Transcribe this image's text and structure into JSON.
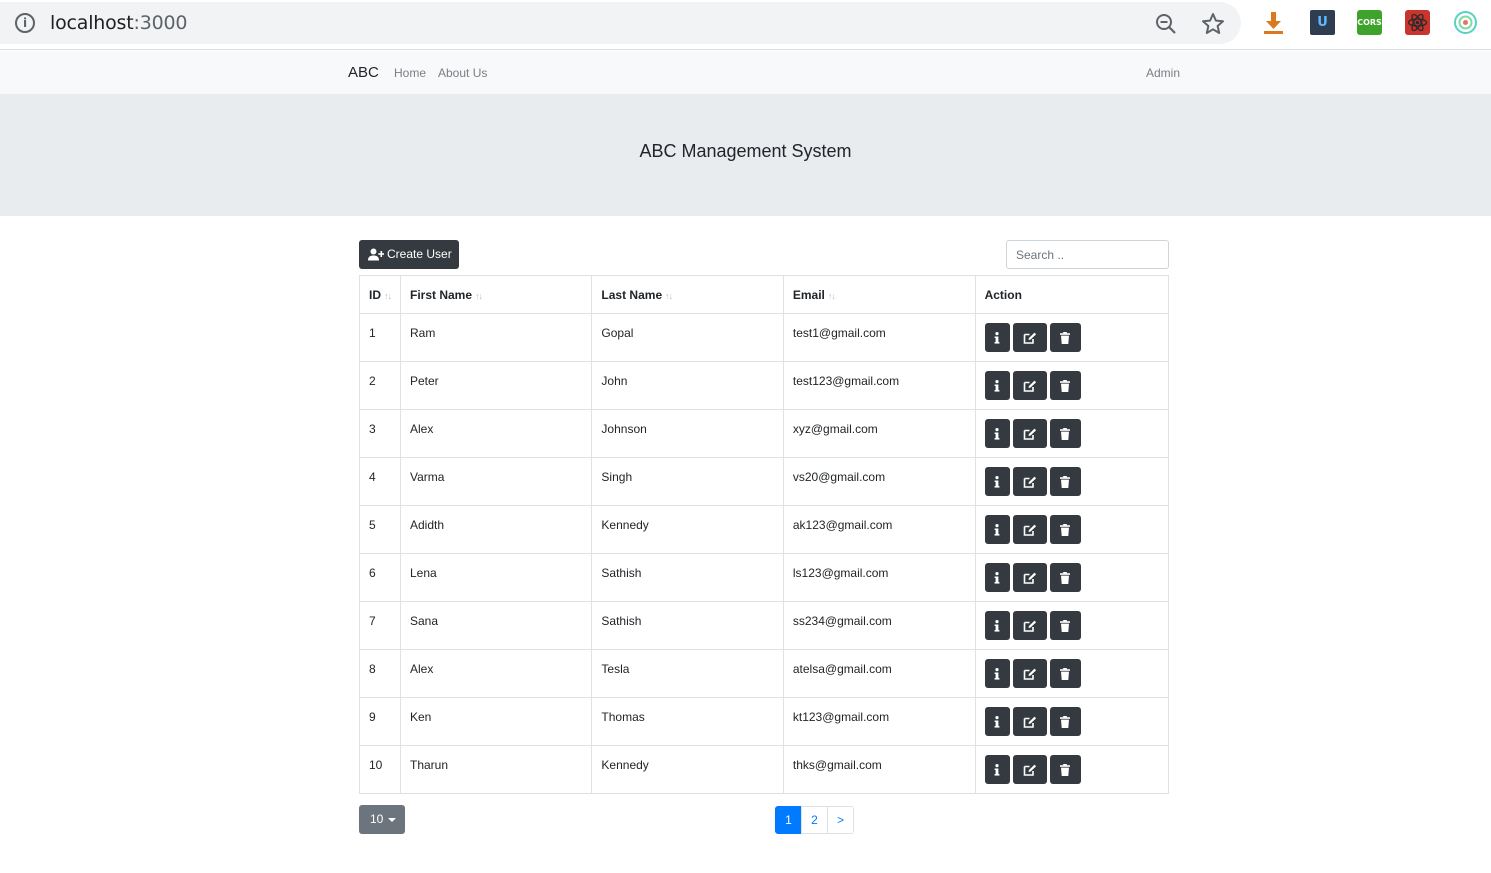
{
  "browser": {
    "url_host": "localhost",
    "url_port": ":3000"
  },
  "navbar": {
    "brand": "ABC",
    "links": [
      "Home",
      "About Us"
    ],
    "user": "Admin"
  },
  "header": {
    "title": "ABC Management System"
  },
  "toolbar": {
    "create_label": "Create User",
    "search_placeholder": "Search .."
  },
  "table": {
    "columns": [
      "ID",
      "First Name",
      "Last Name",
      "Email",
      "Action"
    ],
    "sort_glyph": "↑↓",
    "rows": [
      {
        "id": "1",
        "first": "Ram",
        "last": "Gopal",
        "email": "test1@gmail.com"
      },
      {
        "id": "2",
        "first": "Peter",
        "last": "John",
        "email": "test123@gmail.com"
      },
      {
        "id": "3",
        "first": "Alex",
        "last": "Johnson",
        "email": "xyz@gmail.com"
      },
      {
        "id": "4",
        "first": "Varma",
        "last": "Singh",
        "email": "vs20@gmail.com"
      },
      {
        "id": "5",
        "first": "Adidth",
        "last": "Kennedy",
        "email": "ak123@gmail.com"
      },
      {
        "id": "6",
        "first": "Lena",
        "last": "Sathish",
        "email": "ls123@gmail.com"
      },
      {
        "id": "7",
        "first": "Sana",
        "last": "Sathish",
        "email": "ss234@gmail.com"
      },
      {
        "id": "8",
        "first": "Alex",
        "last": "Tesla",
        "email": "atelsa@gmail.com"
      },
      {
        "id": "9",
        "first": "Ken",
        "last": "Thomas",
        "email": "kt123@gmail.com"
      },
      {
        "id": "10",
        "first": "Tharun",
        "last": "Kennedy",
        "email": "thks@gmail.com"
      }
    ]
  },
  "pagination": {
    "page_size": "10",
    "pages": [
      "1",
      "2"
    ],
    "next": ">",
    "active_page": "1"
  },
  "extensions": {
    "u_label": "U",
    "cors_label": "CORS"
  },
  "colors": {
    "dark_button": "#343a40",
    "primary": "#007bff",
    "secondary": "#6c757d",
    "jumbotron": "#e9ecef",
    "navbar": "#f8f9fa"
  }
}
